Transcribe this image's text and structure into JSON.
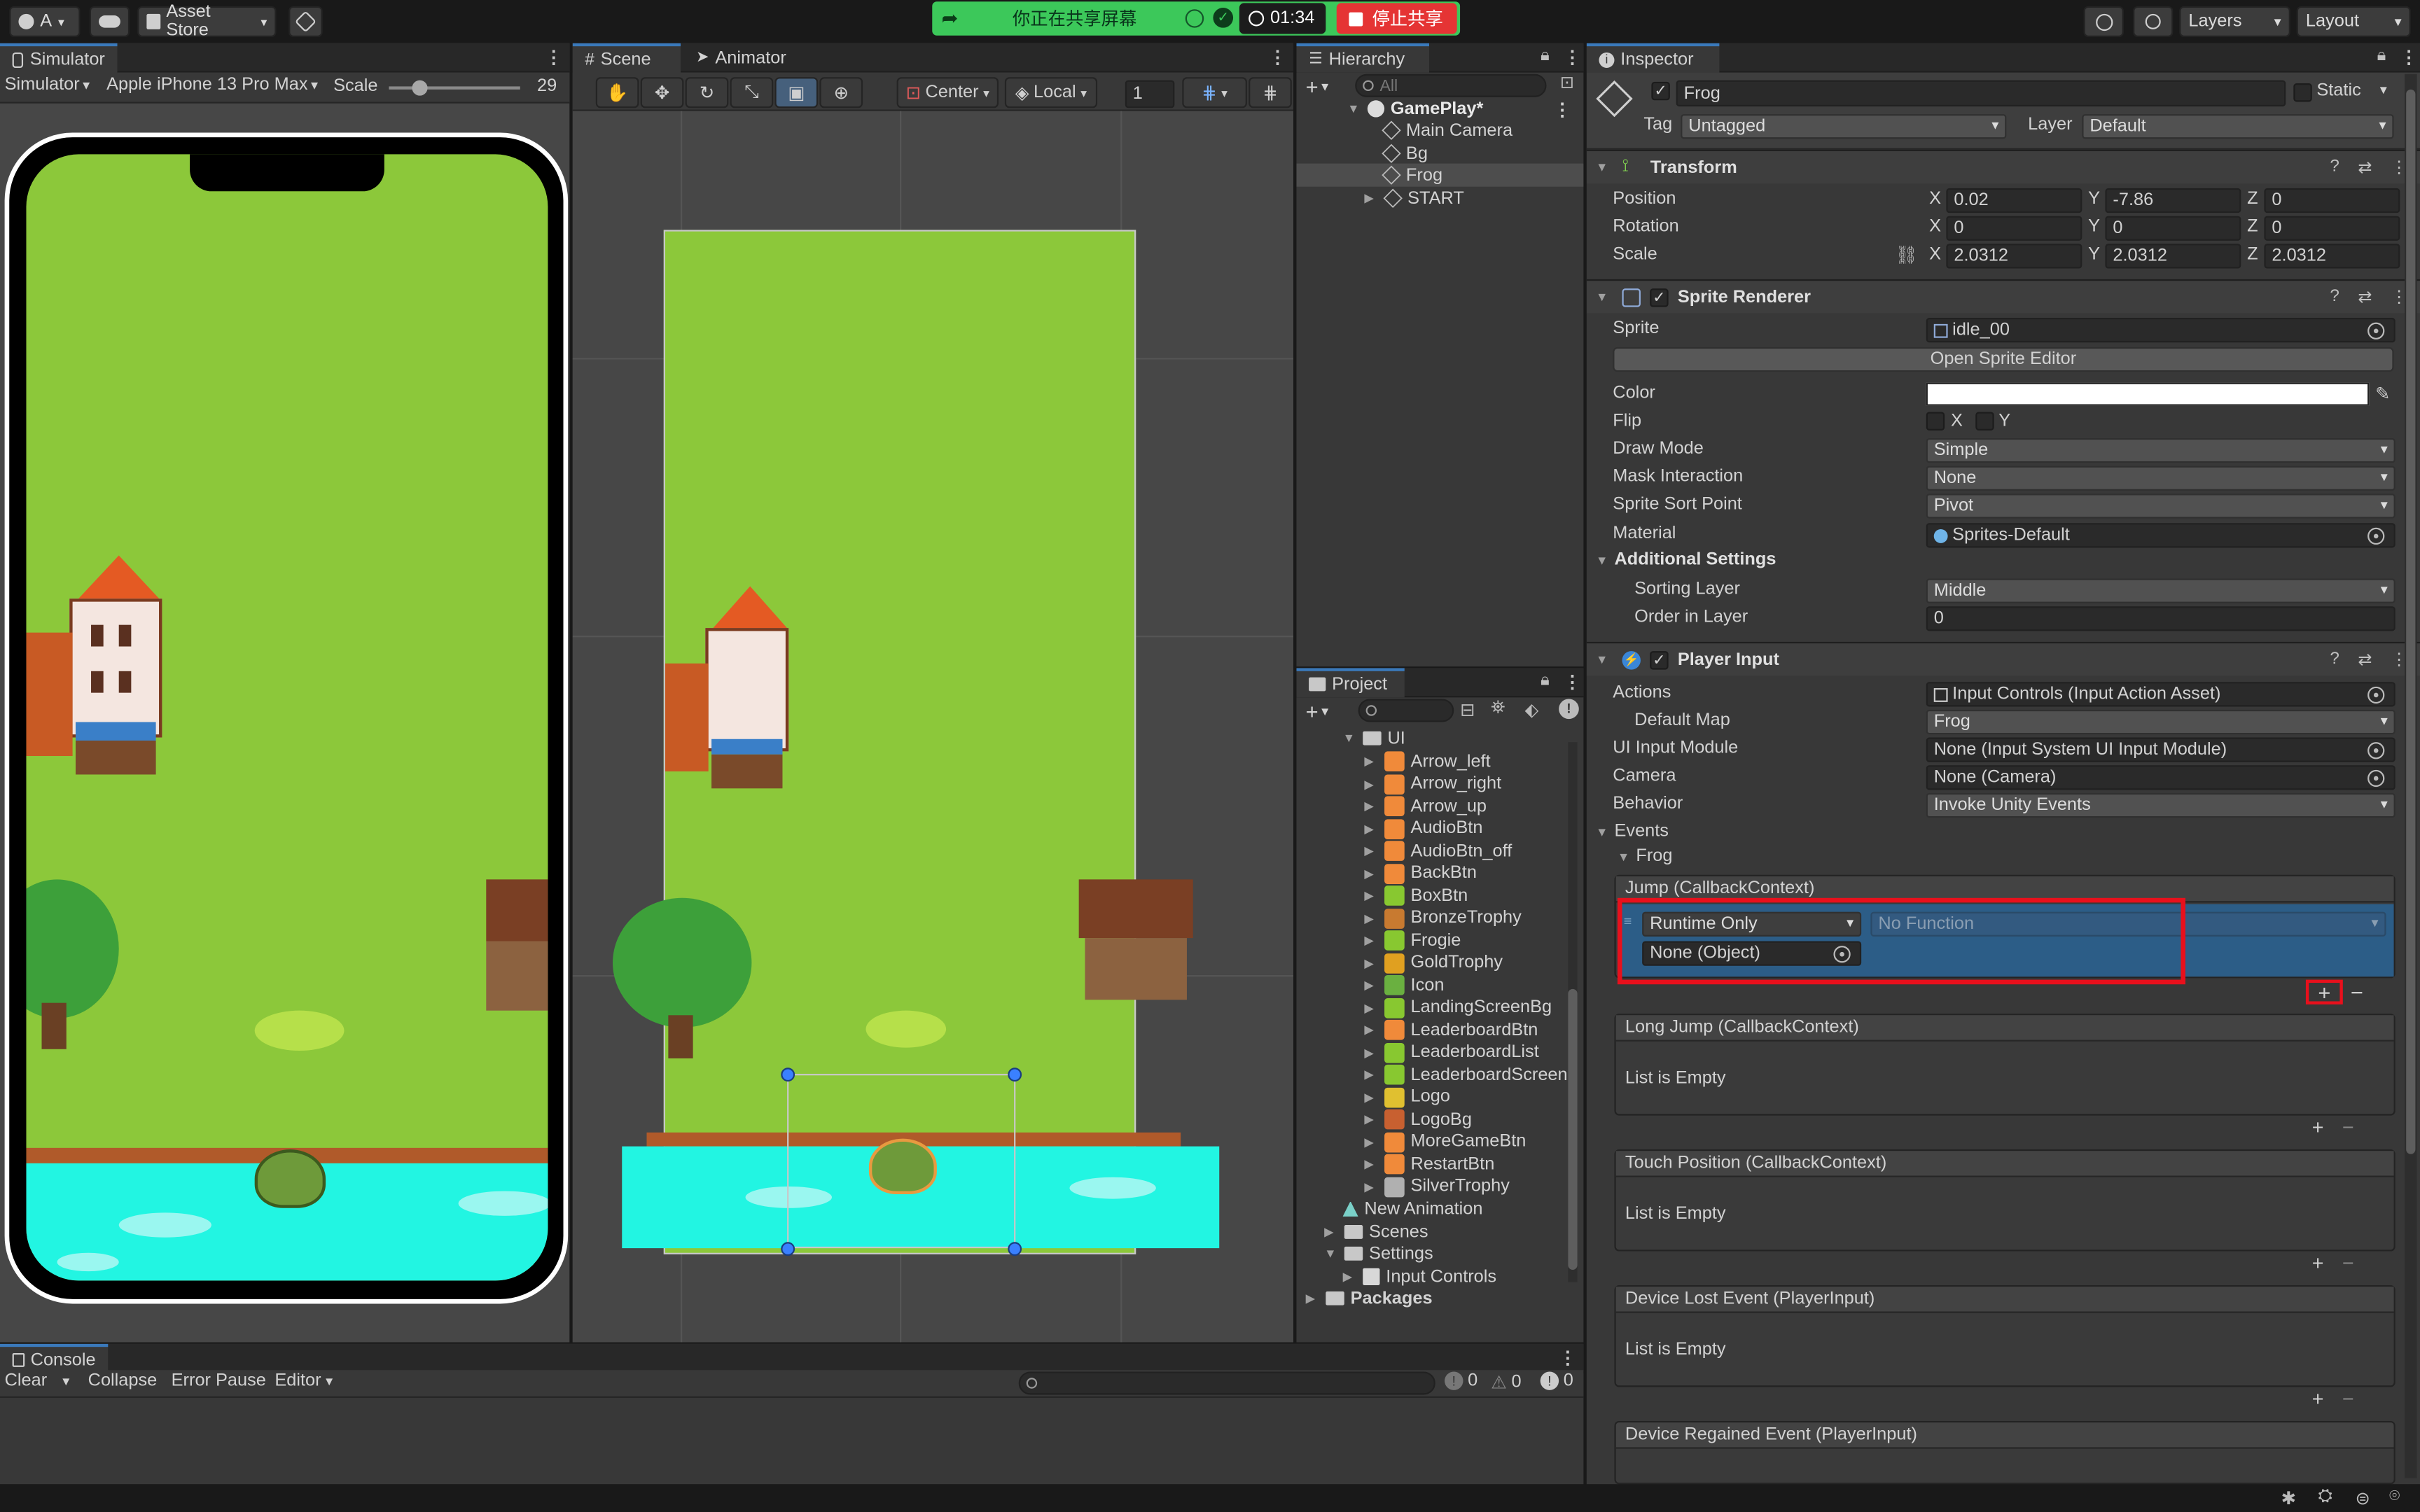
{
  "toolbar": {
    "account_label": "A",
    "asset_store_label": "Asset Store",
    "share_text": "你正在共享屏幕",
    "timer": "01:34",
    "stop_share_label": "停止共享",
    "layers_label": "Layers",
    "layout_label": "Layout"
  },
  "simulator": {
    "tab": "Simulator",
    "mode": "Simulator",
    "device": "Apple iPhone 13 Pro Max",
    "scale_label": "Scale",
    "scale_value": "29"
  },
  "scene": {
    "tabs": [
      "Scene",
      "Animator"
    ],
    "center_label": "Center",
    "local_label": "Local",
    "grid_value": "1"
  },
  "hierarchy": {
    "tab": "Hierarchy",
    "search_placeholder": "All",
    "root": "GamePlay*",
    "items": [
      "Main Camera",
      "Bg",
      "Frog",
      "START"
    ]
  },
  "project": {
    "tab": "Project",
    "folder": "UI",
    "items": [
      "Arrow_left",
      "Arrow_right",
      "Arrow_up",
      "AudioBtn",
      "AudioBtn_off",
      "BackBtn",
      "BoxBtn",
      "BronzeTrophy",
      "Frogie",
      "GoldTrophy",
      "Icon",
      "LandingScreenBg",
      "LeaderboardBtn",
      "LeaderboardList",
      "LeaderboardScreen",
      "Logo",
      "LogoBg",
      "MoreGameBtn",
      "RestartBtn",
      "SilverTrophy"
    ],
    "after": [
      "New Animation",
      "Scenes",
      "Settings",
      "Input Controls",
      "Packages"
    ]
  },
  "inspector": {
    "tab": "Inspector",
    "object_name": "Frog",
    "static_label": "Static",
    "tag_label": "Tag",
    "tag_value": "Untagged",
    "layer_label": "Layer",
    "layer_value": "Default",
    "transform": {
      "title": "Transform",
      "rows": [
        {
          "label": "Position",
          "x": "0.02",
          "y": "-7.86",
          "z": "0"
        },
        {
          "label": "Rotation",
          "x": "0",
          "y": "0",
          "z": "0"
        },
        {
          "label": "Scale",
          "x": "2.0312",
          "y": "2.0312",
          "z": "2.0312"
        }
      ]
    },
    "sprite_renderer": {
      "title": "Sprite Renderer",
      "sprite_label": "Sprite",
      "sprite_value": "idle_00",
      "open_editor": "Open Sprite Editor",
      "color_label": "Color",
      "flip_label": "Flip",
      "flip_x": "X",
      "flip_y": "Y",
      "draw_mode_label": "Draw Mode",
      "draw_mode_value": "Simple",
      "mask_label": "Mask Interaction",
      "mask_value": "None",
      "sort_point_label": "Sprite Sort Point",
      "sort_point_value": "Pivot",
      "material_label": "Material",
      "material_value": "Sprites-Default",
      "additional_label": "Additional Settings",
      "sorting_layer_label": "Sorting Layer",
      "sorting_layer_value": "Middle",
      "order_label": "Order in Layer",
      "order_value": "0"
    },
    "player_input": {
      "title": "Player Input",
      "actions_label": "Actions",
      "actions_value": "Input Controls (Input Action Asset)",
      "default_map_label": "Default Map",
      "default_map_value": "Frog",
      "ui_module_label": "UI Input Module",
      "ui_module_value": "None (Input System UI Input Module)",
      "camera_label": "Camera",
      "camera_value": "None (Camera)",
      "behavior_label": "Behavior",
      "behavior_value": "Invoke Unity Events",
      "events_label": "Events",
      "frog_label": "Frog",
      "jump_title": "Jump (CallbackContext)",
      "runtime_value": "Runtime Only",
      "function_value": "No Function",
      "object_value": "None (Object)",
      "long_jump_title": "Long Jump (CallbackContext)",
      "touch_title": "Touch Position (CallbackContext)",
      "lost_title": "Device Lost Event (PlayerInput)",
      "regained_title": "Device Regained Event (PlayerInput)",
      "empty_text": "List is Empty"
    }
  },
  "console": {
    "tab": "Console",
    "clear": "Clear",
    "collapse": "Collapse",
    "error_pause": "Error Pause",
    "editor": "Editor",
    "errors": "0",
    "warnings": "0",
    "messages": "0"
  },
  "colors": {
    "grass": "#8cc83a",
    "water": "#22f5e2",
    "highlight_red": "#e8101c",
    "selection_blue": "#2c5d87",
    "share_green": "#3cc85a"
  }
}
